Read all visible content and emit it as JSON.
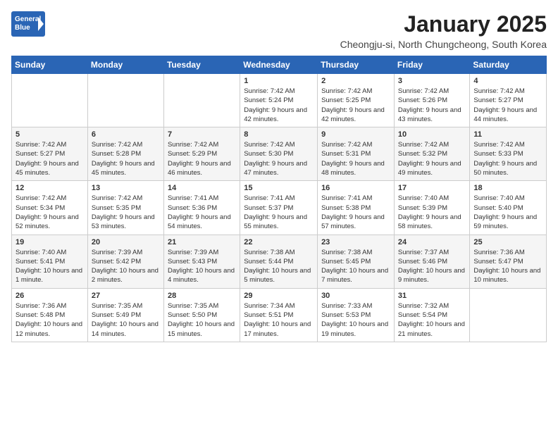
{
  "header": {
    "logo_general": "General",
    "logo_blue": "Blue",
    "title": "January 2025",
    "subtitle": "Cheongju-si, North Chungcheong, South Korea"
  },
  "columns": [
    "Sunday",
    "Monday",
    "Tuesday",
    "Wednesday",
    "Thursday",
    "Friday",
    "Saturday"
  ],
  "weeks": [
    {
      "days": [
        {
          "number": "",
          "info": ""
        },
        {
          "number": "",
          "info": ""
        },
        {
          "number": "",
          "info": ""
        },
        {
          "number": "1",
          "info": "Sunrise: 7:42 AM\nSunset: 5:24 PM\nDaylight: 9 hours and 42 minutes."
        },
        {
          "number": "2",
          "info": "Sunrise: 7:42 AM\nSunset: 5:25 PM\nDaylight: 9 hours and 42 minutes."
        },
        {
          "number": "3",
          "info": "Sunrise: 7:42 AM\nSunset: 5:26 PM\nDaylight: 9 hours and 43 minutes."
        },
        {
          "number": "4",
          "info": "Sunrise: 7:42 AM\nSunset: 5:27 PM\nDaylight: 9 hours and 44 minutes."
        }
      ]
    },
    {
      "days": [
        {
          "number": "5",
          "info": "Sunrise: 7:42 AM\nSunset: 5:27 PM\nDaylight: 9 hours and 45 minutes."
        },
        {
          "number": "6",
          "info": "Sunrise: 7:42 AM\nSunset: 5:28 PM\nDaylight: 9 hours and 45 minutes."
        },
        {
          "number": "7",
          "info": "Sunrise: 7:42 AM\nSunset: 5:29 PM\nDaylight: 9 hours and 46 minutes."
        },
        {
          "number": "8",
          "info": "Sunrise: 7:42 AM\nSunset: 5:30 PM\nDaylight: 9 hours and 47 minutes."
        },
        {
          "number": "9",
          "info": "Sunrise: 7:42 AM\nSunset: 5:31 PM\nDaylight: 9 hours and 48 minutes."
        },
        {
          "number": "10",
          "info": "Sunrise: 7:42 AM\nSunset: 5:32 PM\nDaylight: 9 hours and 49 minutes."
        },
        {
          "number": "11",
          "info": "Sunrise: 7:42 AM\nSunset: 5:33 PM\nDaylight: 9 hours and 50 minutes."
        }
      ]
    },
    {
      "days": [
        {
          "number": "12",
          "info": "Sunrise: 7:42 AM\nSunset: 5:34 PM\nDaylight: 9 hours and 52 minutes."
        },
        {
          "number": "13",
          "info": "Sunrise: 7:42 AM\nSunset: 5:35 PM\nDaylight: 9 hours and 53 minutes."
        },
        {
          "number": "14",
          "info": "Sunrise: 7:41 AM\nSunset: 5:36 PM\nDaylight: 9 hours and 54 minutes."
        },
        {
          "number": "15",
          "info": "Sunrise: 7:41 AM\nSunset: 5:37 PM\nDaylight: 9 hours and 55 minutes."
        },
        {
          "number": "16",
          "info": "Sunrise: 7:41 AM\nSunset: 5:38 PM\nDaylight: 9 hours and 57 minutes."
        },
        {
          "number": "17",
          "info": "Sunrise: 7:40 AM\nSunset: 5:39 PM\nDaylight: 9 hours and 58 minutes."
        },
        {
          "number": "18",
          "info": "Sunrise: 7:40 AM\nSunset: 5:40 PM\nDaylight: 9 hours and 59 minutes."
        }
      ]
    },
    {
      "days": [
        {
          "number": "19",
          "info": "Sunrise: 7:40 AM\nSunset: 5:41 PM\nDaylight: 10 hours and 1 minute."
        },
        {
          "number": "20",
          "info": "Sunrise: 7:39 AM\nSunset: 5:42 PM\nDaylight: 10 hours and 2 minutes."
        },
        {
          "number": "21",
          "info": "Sunrise: 7:39 AM\nSunset: 5:43 PM\nDaylight: 10 hours and 4 minutes."
        },
        {
          "number": "22",
          "info": "Sunrise: 7:38 AM\nSunset: 5:44 PM\nDaylight: 10 hours and 5 minutes."
        },
        {
          "number": "23",
          "info": "Sunrise: 7:38 AM\nSunset: 5:45 PM\nDaylight: 10 hours and 7 minutes."
        },
        {
          "number": "24",
          "info": "Sunrise: 7:37 AM\nSunset: 5:46 PM\nDaylight: 10 hours and 9 minutes."
        },
        {
          "number": "25",
          "info": "Sunrise: 7:36 AM\nSunset: 5:47 PM\nDaylight: 10 hours and 10 minutes."
        }
      ]
    },
    {
      "days": [
        {
          "number": "26",
          "info": "Sunrise: 7:36 AM\nSunset: 5:48 PM\nDaylight: 10 hours and 12 minutes."
        },
        {
          "number": "27",
          "info": "Sunrise: 7:35 AM\nSunset: 5:49 PM\nDaylight: 10 hours and 14 minutes."
        },
        {
          "number": "28",
          "info": "Sunrise: 7:35 AM\nSunset: 5:50 PM\nDaylight: 10 hours and 15 minutes."
        },
        {
          "number": "29",
          "info": "Sunrise: 7:34 AM\nSunset: 5:51 PM\nDaylight: 10 hours and 17 minutes."
        },
        {
          "number": "30",
          "info": "Sunrise: 7:33 AM\nSunset: 5:53 PM\nDaylight: 10 hours and 19 minutes."
        },
        {
          "number": "31",
          "info": "Sunrise: 7:32 AM\nSunset: 5:54 PM\nDaylight: 10 hours and 21 minutes."
        },
        {
          "number": "",
          "info": ""
        }
      ]
    }
  ]
}
